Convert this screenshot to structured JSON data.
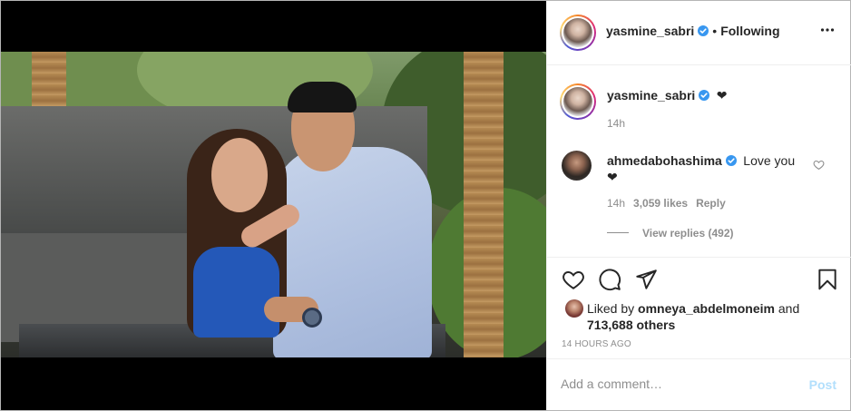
{
  "post": {
    "image_alt": "Photo of a couple posing by a table outdoors"
  },
  "header": {
    "username": "yasmine_sabri",
    "separator": "•",
    "follow_status": "Following"
  },
  "caption": {
    "username": "yasmine_sabri",
    "text": "❤",
    "time": "14h"
  },
  "comment": {
    "username": "ahmedabohashima",
    "text_line1": "Love you",
    "text_line2": "❤",
    "time": "14h",
    "likes": "3,059 likes",
    "reply_label": "Reply",
    "view_replies": "View replies (492)"
  },
  "likes": {
    "prefix": "Liked by ",
    "user": "omneya_abdelmoneim",
    "middle": " and",
    "count": "713,688 others"
  },
  "timestamp": "14 HOURS AGO",
  "add_comment": {
    "placeholder": "Add a comment…",
    "post_label": "Post"
  },
  "colors": {
    "verified": "#3897f0",
    "post_disabled": "#b2dffc",
    "secondary_text": "#8e8e8e"
  },
  "icons": {
    "header_more": "more-dots-icon",
    "like": "heart-icon",
    "comment": "comment-icon",
    "share": "share-icon",
    "save": "bookmark-icon",
    "comment_like": "small-heart-icon",
    "verified": "verified-badge-icon"
  }
}
